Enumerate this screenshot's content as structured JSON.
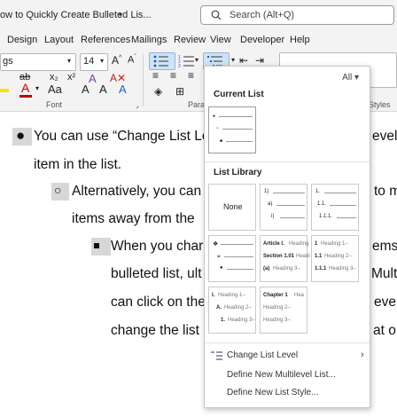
{
  "titlebar": {
    "title": "ow to Quickly Create Bulleted Lis...",
    "caret": "▾",
    "search_placeholder": "Search (Alt+Q)"
  },
  "menu": [
    "Design",
    "Layout",
    "References",
    "Mailings",
    "Review",
    "View",
    "Developer",
    "Help"
  ],
  "ribbon": {
    "style_value": "gs",
    "font_size": "14",
    "font_group": "Font",
    "paragraph_group": "Parag",
    "styles_group": "Styles",
    "bold_x2": "x₂",
    "bold_x2sup": "x²",
    "clear_format": "A"
  },
  "document": {
    "lines": [
      "You can use “Change List Lev",
      "evel",
      "item in the list.",
      "Alternatively, you can",
      "to m",
      "items away from the",
      "When you char",
      "ems",
      "bulleted list, ult",
      "Multi",
      "can click on the",
      "eve",
      "change the list",
      "at o"
    ]
  },
  "gallery": {
    "filter": "All",
    "current_list_heading": "Current List",
    "list_library_heading": "List Library",
    "none_label": "None",
    "tile2": [
      "1)",
      "a)",
      "i)"
    ],
    "tile3": [
      "1.",
      "1.1.",
      "1.1.1."
    ],
    "tile5": [
      "Article I.",
      "Heading",
      "Section 1.01",
      "Headi",
      "(a)",
      "Heading 3–"
    ],
    "tile6": [
      "1",
      "Heading 1–",
      "1.1",
      "Heading 2–",
      "1.1.1",
      "Heading 3–"
    ],
    "tile7": [
      "I.",
      "Heading 1–",
      "A.",
      "Heading 2–",
      "1.",
      "Heading 3–"
    ],
    "tile8": [
      "Chapter 1",
      "Hea",
      "Heading 2–",
      "Heading 3–"
    ],
    "change_level": "Change List Level",
    "define_multilevel": "Define New Multilevel List...",
    "define_style": "Define New List Style..."
  },
  "colors": {
    "accent": "#185abd",
    "highlight": "#f5e400",
    "font_red": "#c00000"
  }
}
